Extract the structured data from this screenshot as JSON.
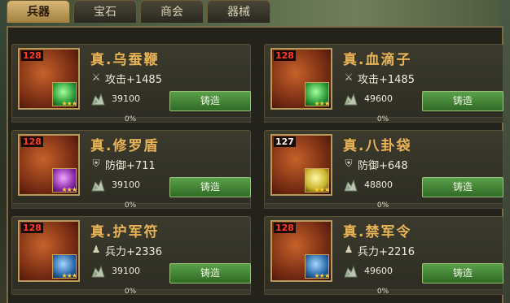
{
  "tabs": [
    {
      "label": "兵器",
      "active": true
    },
    {
      "label": "宝石",
      "active": false
    },
    {
      "label": "商会",
      "active": false
    },
    {
      "label": "器械",
      "active": false
    }
  ],
  "items": [
    {
      "name": "真.乌蚕鞭",
      "level": "128",
      "stat_icon": "sword-icon",
      "stat": "攻击+1485",
      "cost": "39100",
      "forge": "铸造",
      "progress": "0%",
      "gem": "green"
    },
    {
      "name": "真.血滴子",
      "level": "128",
      "stat_icon": "sword-icon",
      "stat": "攻击+1485",
      "cost": "49600",
      "forge": "铸造",
      "progress": "0%",
      "gem": "green"
    },
    {
      "name": "真.修罗盾",
      "level": "128",
      "stat_icon": "shield-icon",
      "stat": "防御+711",
      "cost": "39100",
      "forge": "铸造",
      "progress": "0%",
      "gem": "purple"
    },
    {
      "name": "真.八卦袋",
      "level": "127",
      "stat_icon": "shield-icon",
      "stat": "防御+648",
      "cost": "48800",
      "forge": "铸造",
      "progress": "0%",
      "gem": "yellow"
    },
    {
      "name": "真.护军符",
      "level": "128",
      "stat_icon": "soldier-icon",
      "stat": "兵力+2336",
      "cost": "39100",
      "forge": "铸造",
      "progress": "0%",
      "gem": "blue"
    },
    {
      "name": "真.禁军令",
      "level": "128",
      "stat_icon": "soldier-icon",
      "stat": "兵力+2216",
      "cost": "49600",
      "forge": "铸造",
      "progress": "0%",
      "gem": "blue"
    }
  ],
  "stars": "★★★",
  "colors": {
    "name": "#e8b457",
    "level": "#ff3a2a",
    "forge_button": "#4a8a3a"
  }
}
